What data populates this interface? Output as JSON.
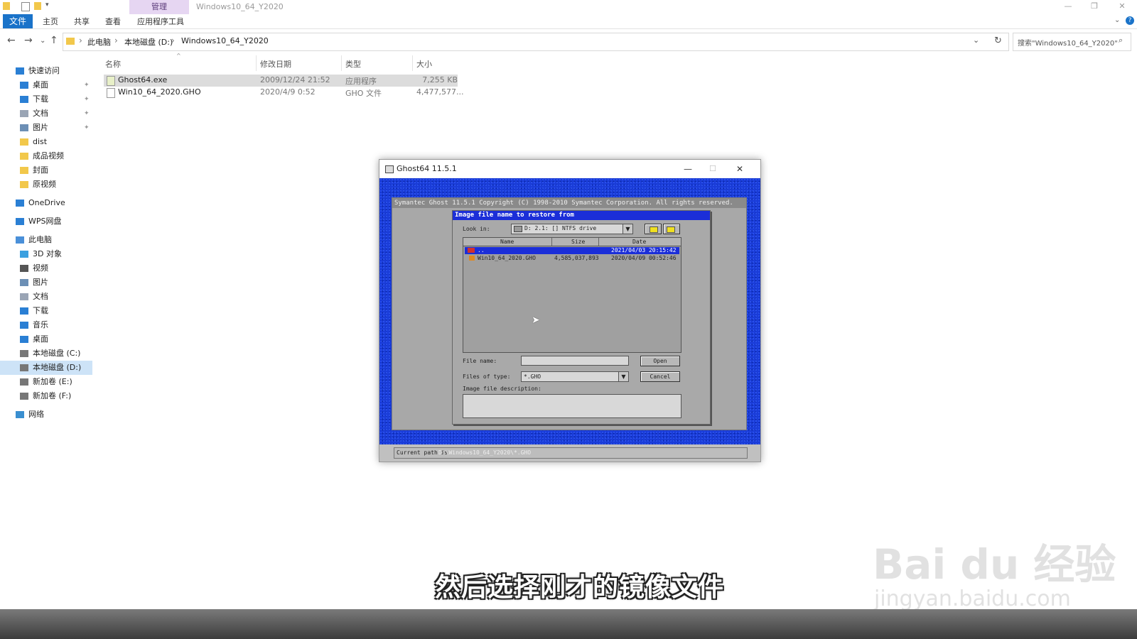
{
  "explorer": {
    "window_title": "Windows10_64_Y2020",
    "contextual_tab_group": "管理",
    "ribbon_tabs": [
      "文件",
      "主页",
      "共享",
      "查看",
      "应用程序工具"
    ],
    "breadcrumb": [
      "此电脑",
      "本地磁盘 (D:)",
      "Windows10_64_Y2020"
    ],
    "search_placeholder": "搜索\"Windows10_64_Y2020\"",
    "sidebar": [
      {
        "label": "快速访问",
        "icon": "star-icon",
        "level": 0
      },
      {
        "label": "桌面",
        "icon": "desktop-icon",
        "level": 1,
        "pinned": true
      },
      {
        "label": "下载",
        "icon": "download-icon",
        "level": 1,
        "pinned": true
      },
      {
        "label": "文档",
        "icon": "document-icon",
        "level": 1,
        "pinned": true
      },
      {
        "label": "图片",
        "icon": "picture-icon",
        "level": 1,
        "pinned": true
      },
      {
        "label": "dist",
        "icon": "folder-icon",
        "level": 1
      },
      {
        "label": "成品视频",
        "icon": "folder-icon",
        "level": 1
      },
      {
        "label": "封面",
        "icon": "folder-icon",
        "level": 1
      },
      {
        "label": "原视频",
        "icon": "folder-icon",
        "level": 1
      },
      {
        "label": "OneDrive",
        "icon": "cloud-icon",
        "level": 0
      },
      {
        "label": "WPS网盘",
        "icon": "cloud-icon",
        "level": 0
      },
      {
        "label": "此电脑",
        "icon": "computer-icon",
        "level": 0
      },
      {
        "label": "3D 对象",
        "icon": "cube-icon",
        "level": 1
      },
      {
        "label": "视频",
        "icon": "video-icon",
        "level": 1
      },
      {
        "label": "图片",
        "icon": "picture-icon",
        "level": 1
      },
      {
        "label": "文档",
        "icon": "document-icon",
        "level": 1
      },
      {
        "label": "下载",
        "icon": "download-icon",
        "level": 1
      },
      {
        "label": "音乐",
        "icon": "music-icon",
        "level": 1
      },
      {
        "label": "桌面",
        "icon": "desktop-icon",
        "level": 1
      },
      {
        "label": "本地磁盘 (C:)",
        "icon": "drive-icon",
        "level": 1
      },
      {
        "label": "本地磁盘 (D:)",
        "icon": "drive-icon",
        "level": 1,
        "selected": true
      },
      {
        "label": "新加卷 (E:)",
        "icon": "drive-icon",
        "level": 1
      },
      {
        "label": "新加卷 (F:)",
        "icon": "drive-icon",
        "level": 1
      },
      {
        "label": "网络",
        "icon": "network-icon",
        "level": 0
      }
    ],
    "columns": [
      "名称",
      "修改日期",
      "类型",
      "大小"
    ],
    "files": [
      {
        "name": "Ghost64.exe",
        "date": "2009/12/24 21:52",
        "type": "应用程序",
        "size": "7,255 KB",
        "selected": true
      },
      {
        "name": "Win10_64_2020.GHO",
        "date": "2020/4/9 0:52",
        "type": "GHO 文件",
        "size": "4,477,577..."
      }
    ]
  },
  "ghost_window": {
    "title": "Ghost64 11.5.1",
    "header": "Symantec Ghost 11.5.1   Copyright (C) 1998-2010 Symantec Corporation. All rights reserved.",
    "dialog": {
      "title": "Image file name to restore from",
      "look_in_label": "Look in:",
      "look_in_value": "D: 2.1: [] NTFS drive",
      "list_headers": [
        "Name",
        "Size",
        "Date"
      ],
      "list_rows": [
        {
          "name": "..",
          "size": "",
          "date": "2021/04/03 20:15:42",
          "selected": true
        },
        {
          "name": "Win10_64_2020.GHO",
          "size": "4,585,037,893",
          "date": "2020/04/09 00:52:46"
        }
      ],
      "file_name_label": "File name:",
      "file_name_value": "",
      "files_of_type_label": "Files of type:",
      "files_of_type_value": "*.GHO",
      "open_button": "Open",
      "cancel_button": "Cancel",
      "description_label": "Image file description:"
    },
    "status": {
      "label": "Current path is",
      "path": "D:\\Windows10_64_Y2020\\*.GHO"
    }
  },
  "overlay": {
    "subtitle": "然后选择刚才的镜像文件",
    "watermark_brand": "Bai du 经验",
    "watermark_url": "jingyan.baidu.com"
  },
  "colors": {
    "ghost_blue": "#1a3cd8",
    "ribbon_accent": "#1a73c9",
    "manage_band": "#e6d6f2"
  }
}
